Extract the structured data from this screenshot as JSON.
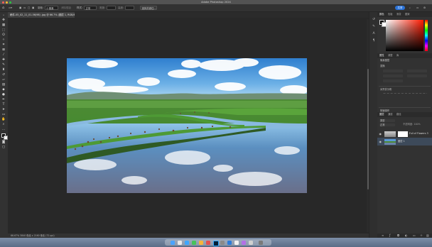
{
  "app": {
    "window_title": "Adobe Photoshop 2024"
  },
  "options_bar": {
    "items": [
      "▣",
      "▭",
      "▢",
      "▣",
      "羽化:",
      "0 像素",
      "消除锯齿",
      "样式:",
      "正常",
      "宽度:",
      "高度:",
      "选择并遮住..."
    ],
    "share_label": "共享"
  },
  "document": {
    "tab_label": "稿件-05_02_11_01-56(98) .jpg @ 66.7% (图层 1, RGB/8) *"
  },
  "status": {
    "text": "66.67%   3840 像素 x 2160 像素 (72 ppi)"
  },
  "panels": {
    "color_tabs": [
      "颜色",
      "色板",
      "渐变",
      "图案"
    ],
    "props_tabs": [
      "属性",
      "调整",
      "库"
    ],
    "props_title": "像素图层",
    "transform_label": "变换",
    "align_label": "对齐并分布",
    "quick_actions_label": "快速操作",
    "layers_tabs": [
      "图层",
      "通道",
      "路径"
    ],
    "layer_kind": "类型",
    "layer_mode": "正常",
    "layer_opacity_label": "不透明度: 100%",
    "layers": [
      {
        "name": "Full of Flowers 3",
        "visible": true,
        "type": "adjust"
      },
      {
        "name": "图层 1",
        "visible": true,
        "type": "photo"
      }
    ]
  },
  "colors": {
    "accent": "#2a73d9",
    "panel_bg": "#323232",
    "canvas_bg": "#282828"
  },
  "icons": [
    "move-icon",
    "artboard-icon",
    "marquee-icon",
    "lasso-icon",
    "magic-wand-icon",
    "crop-icon",
    "frame-icon",
    "eyedropper-icon",
    "healing-icon",
    "brush-icon",
    "clone-stamp-icon",
    "history-brush-icon",
    "eraser-icon",
    "gradient-icon",
    "blur-icon",
    "dodge-icon",
    "pen-icon",
    "type-icon",
    "path-select-icon",
    "rectangle-icon",
    "hand-icon",
    "zoom-icon",
    "more-icon"
  ]
}
